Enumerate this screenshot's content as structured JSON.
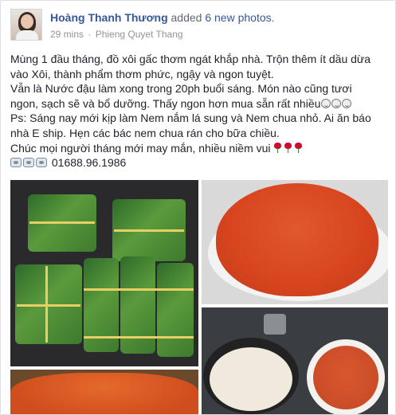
{
  "post": {
    "author": "Hoàng Thanh Thương",
    "action_prefix": "added",
    "action_count": "6 new photos",
    "action_suffix": ".",
    "time": "29 mins",
    "separator": "·",
    "location": "Phieng Quyet Thang",
    "lines": [
      "Mùng 1 đầu tháng, đồ xôi gấc thơm ngát khắp nhà. Trộn thêm ít dầu dừa",
      "vào Xôi, thành phẩm thơm phức, ngậy và ngon tuyệt.",
      "Vẫn là Nước đậu làm xong trong 20ph buổi sáng. Món nào cũng tươi",
      "ngon, sạch sẽ và bổ dưỡng. Thấy ngon hơn mua sẵn rất nhiều",
      "Ps: Sáng nay mới kịp làm Nem nắm lá sung và Nem chua nhỏ. Ai ăn báo",
      "nhà E ship. Hẹn các bác nem chua rán cho bữa chiều.",
      "Chúc mọi người tháng mới may mắn, nhiều niềm vui"
    ],
    "phone": "01688.96.1986"
  },
  "icons": {
    "emoji": "grinning-face-icon",
    "rose": "rose-icon",
    "phone": "telephone-icon"
  },
  "colors": {
    "link": "#365899",
    "meta": "#90949c",
    "text": "#1d2129",
    "border": "#dddfe2"
  }
}
